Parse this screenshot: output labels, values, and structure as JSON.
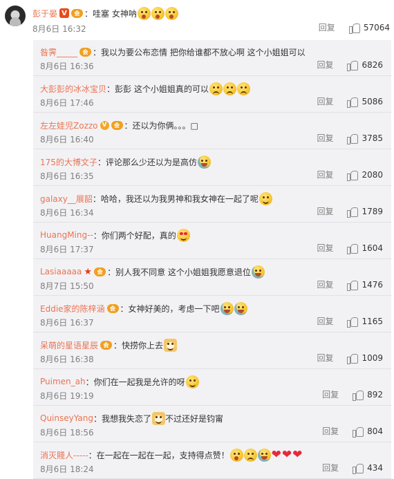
{
  "main": {
    "username": "彭于晏",
    "badge_v": "V",
    "badge_member": "会",
    "text": "：哇塞 女神呐",
    "emojis": [
      "wow",
      "wow",
      "wow"
    ],
    "time": "8月6日 16:32",
    "reply_label": "回复",
    "likes": "57064"
  },
  "replies": [
    {
      "username": "昝霁_____",
      "badges": [
        "member"
      ],
      "text": "：我以为要公布恋情 把你给谁都不放心啊 这个小姐姐可以",
      "emojis": [],
      "time": "8月6日 16:36",
      "reply_label": "回复",
      "likes": "6826"
    },
    {
      "username": "大彭彭的冰冰宝贝",
      "badges": [],
      "text": "：彭彭 这个小姐姐真的可以",
      "emojis": [
        "sad",
        "sad",
        "sad"
      ],
      "time": "8月6日 17:46",
      "reply_label": "回复",
      "likes": "5086"
    },
    {
      "username": "左左娃児Zozzo",
      "badges": [
        "v-gold",
        "member"
      ],
      "text": "：还以为你俩。。。□",
      "emojis": [],
      "time": "8月6日 16:40",
      "reply_label": "回复",
      "likes": "3785"
    },
    {
      "username": "175的大博文子",
      "badges": [],
      "text": "：评论那么少还以为是高仿",
      "emojis": [
        "cry"
      ],
      "time": "8月6日 16:35",
      "reply_label": "回复",
      "likes": "2080"
    },
    {
      "username": "galaxy__展韶",
      "badges": [],
      "text": "：哈哈，我还以为我男神和我女神在一起了呢",
      "emojis": [
        "smile"
      ],
      "time": "8月6日 16:34",
      "reply_label": "回复",
      "likes": "1789"
    },
    {
      "username": "HuangMing--",
      "badges": [],
      "text": "：你们两个好配，真的",
      "emojis": [
        "love"
      ],
      "time": "8月6日 17:37",
      "reply_label": "回复",
      "likes": "1604"
    },
    {
      "username": "Lasiaaaaa",
      "badges": [
        "star",
        "member"
      ],
      "text": "：别人我不同意 这个小姐姐我愿意退位",
      "emojis": [
        "cry"
      ],
      "time": "8月7日 15:50",
      "reply_label": "回复",
      "likes": "1476"
    },
    {
      "username": "Eddie家的陈梓涵",
      "badges": [
        "member"
      ],
      "text": "：女神好美的，考虑一下吧",
      "emojis": [
        "cry",
        "cry"
      ],
      "time": "8月6日 16:37",
      "reply_label": "回复",
      "likes": "1165"
    },
    {
      "username": "呆萌的星语星辰",
      "badges": [
        "member"
      ],
      "text": "：快捞你上去",
      "emojis": [
        "dog"
      ],
      "time": "8月6日 16:38",
      "reply_label": "回复",
      "likes": "1009"
    },
    {
      "username": "Puimen_ah",
      "badges": [],
      "text": "：你们在一起我是允许的呀",
      "emojis": [
        "smile"
      ],
      "time": "8月6日 19:19",
      "reply_label": "回复",
      "likes": "892"
    },
    {
      "username": "QuinseyYang",
      "badges": [],
      "text": "：我想我失恋了",
      "emojis": [
        "dog"
      ],
      "text2": "不过还好是钧甯",
      "time": "8月6日 18:56",
      "reply_label": "回复",
      "likes": "804"
    },
    {
      "username": "消灭賤人-----",
      "badges": [],
      "text": "：在一起在一起在一起，支持得点赞！",
      "emojis": [
        "wow",
        "sad",
        "cry"
      ],
      "hearts": 3,
      "time": "8月6日 18:24",
      "reply_label": "回复",
      "likes": "434"
    }
  ]
}
